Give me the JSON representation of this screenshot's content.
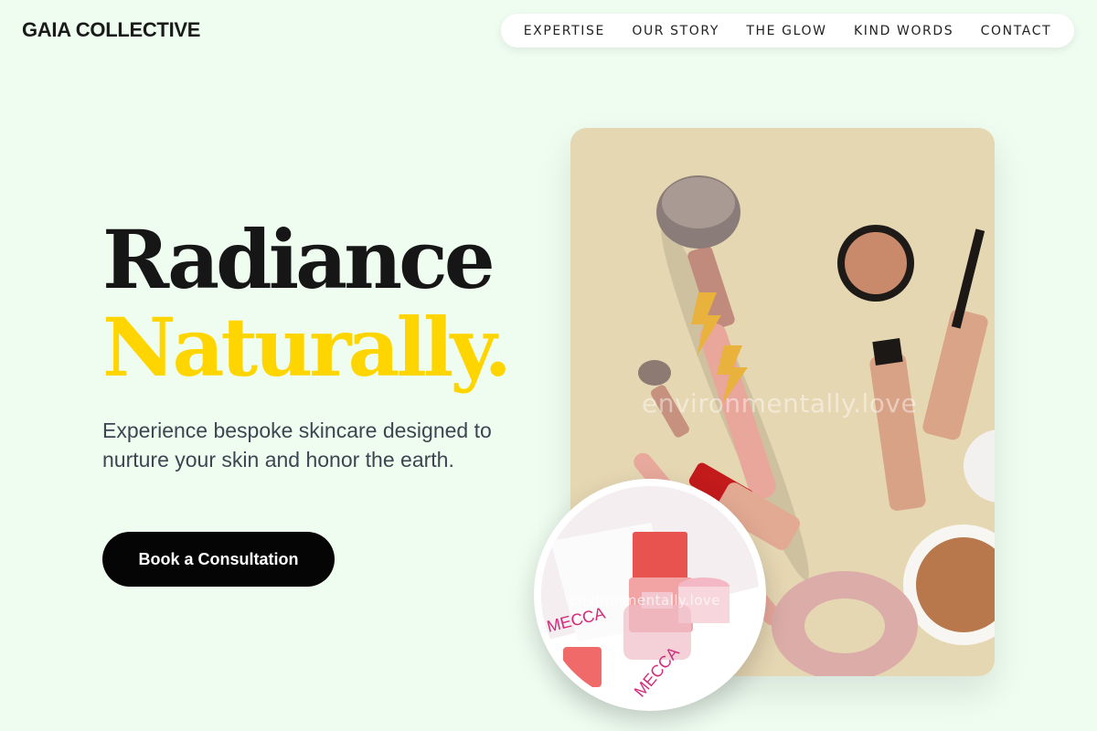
{
  "brand": {
    "name": "GAIA COLLECTIVE"
  },
  "nav": {
    "items": [
      {
        "label": "EXPERTISE"
      },
      {
        "label": "OUR STORY"
      },
      {
        "label": "THE GLOW"
      },
      {
        "label": "KIND WORDS"
      },
      {
        "label": "CONTACT"
      }
    ]
  },
  "hero": {
    "headline_line1": "Radiance",
    "headline_line2": "Naturally.",
    "subcopy": "Experience bespoke skincare designed to nurture your skin and honor the earth.",
    "cta_label": "Book a Consultation"
  },
  "images": {
    "main_watermark": "environmentally.love",
    "circle_watermark": "environmentally.love"
  },
  "colors": {
    "background": "#effdf1",
    "accent": "#ffd500",
    "cta": "#050505"
  }
}
